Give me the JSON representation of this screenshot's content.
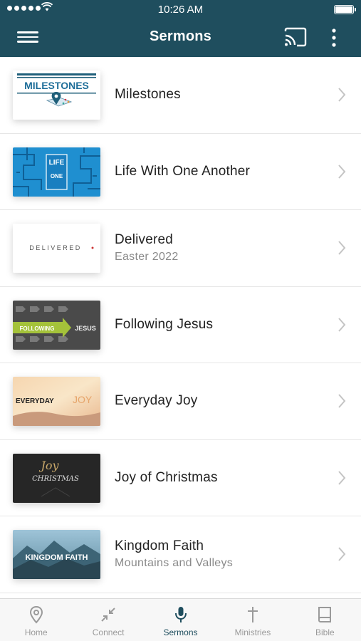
{
  "status_bar": {
    "time": "10:26 AM"
  },
  "header": {
    "title": "Sermons",
    "menu_icon": "hamburger-menu-icon",
    "cast_icon": "cast-icon",
    "more_icon": "more-vertical-icon"
  },
  "sermons": [
    {
      "title": "Milestones",
      "subtitle": "",
      "thumb_text": "MILESTONES"
    },
    {
      "title": "Life With One Another",
      "subtitle": "",
      "thumb_text": "LIFE"
    },
    {
      "title": "Delivered",
      "subtitle": "Easter 2022",
      "thumb_text": "DELIVERED"
    },
    {
      "title": "Following Jesus",
      "subtitle": "",
      "thumb_text": "FOLLOWING"
    },
    {
      "title": "Everyday Joy",
      "subtitle": "",
      "thumb_text": "EVERYDAY"
    },
    {
      "title": "Joy of Christmas",
      "subtitle": "",
      "thumb_text": "CHRISTMAS"
    },
    {
      "title": "Kingdom Faith",
      "subtitle": "Mountains and Valleys",
      "thumb_text": "KINGDOM FAITH"
    }
  ],
  "tabs": [
    {
      "label": "Home",
      "icon": "location-pin-icon"
    },
    {
      "label": "Connect",
      "icon": "compress-arrows-icon"
    },
    {
      "label": "Sermons",
      "icon": "microphone-icon",
      "active": true
    },
    {
      "label": "Ministries",
      "icon": "cross-icon"
    },
    {
      "label": "Bible",
      "icon": "book-icon"
    }
  ],
  "colors": {
    "header_bg": "#1f4e5e",
    "active_tab": "#1f4e5e",
    "inactive_tab": "#9a9a9a"
  }
}
